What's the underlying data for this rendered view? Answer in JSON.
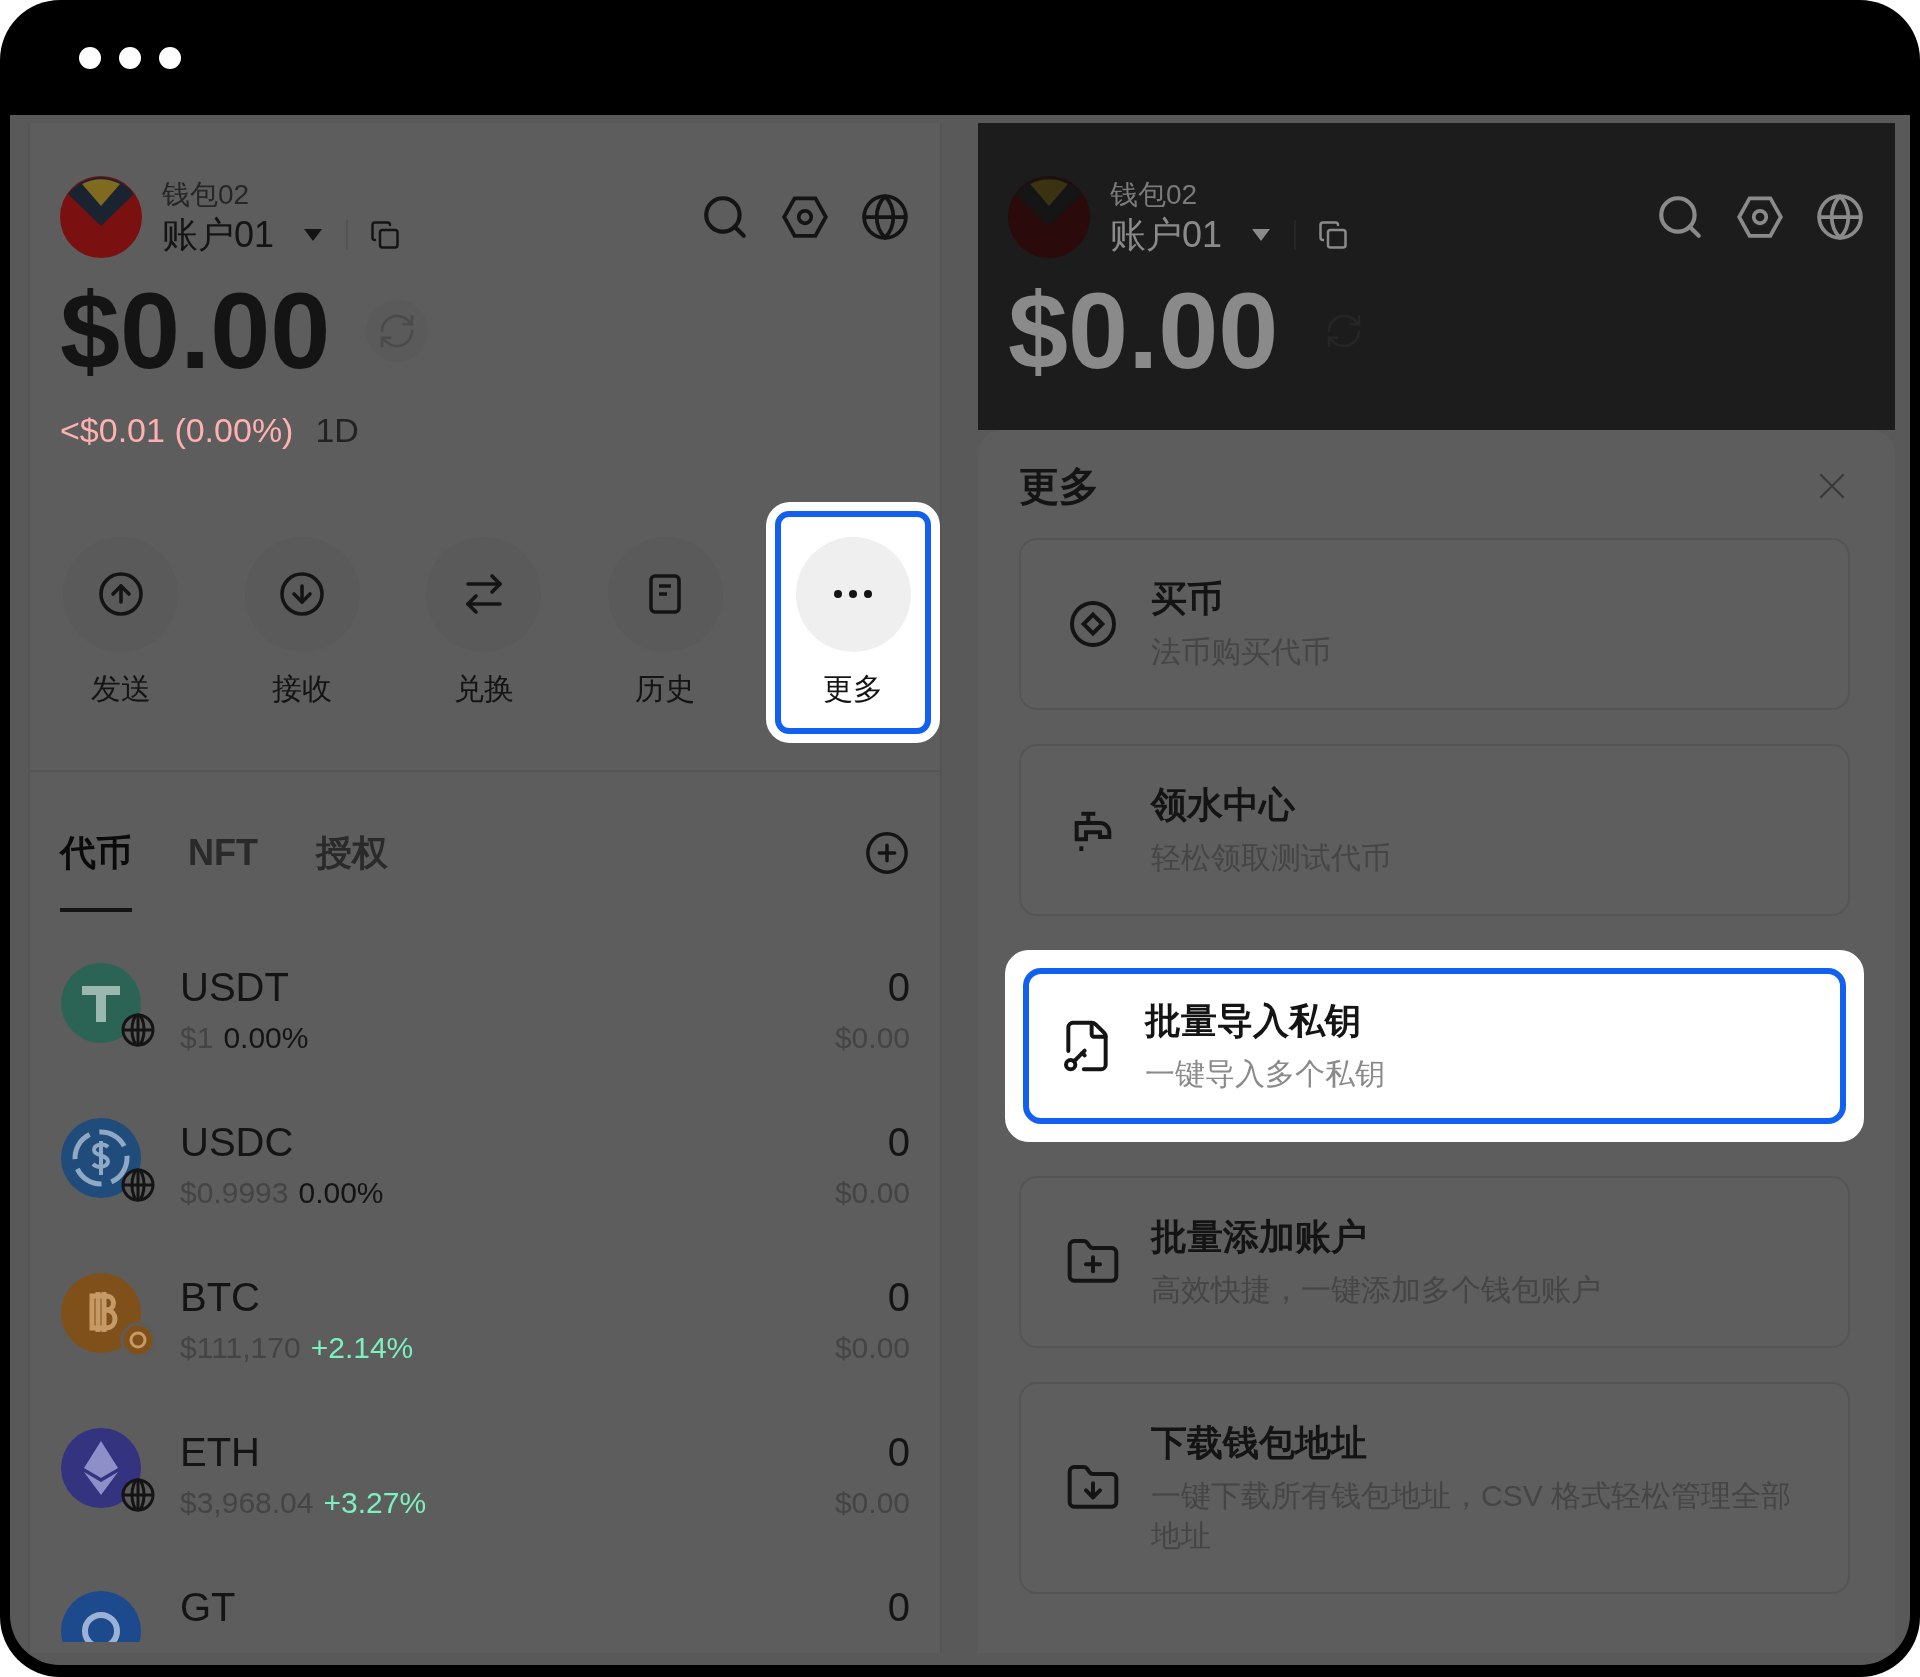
{
  "wallet": {
    "wallet_name": "钱包02",
    "account": "账户01",
    "balance": "$0.00",
    "change": "<$0.01 (0.00%)",
    "period": "1D",
    "actions": [
      {
        "label": "发送",
        "kind": "send",
        "highlighted": false
      },
      {
        "label": "接收",
        "kind": "receive",
        "highlighted": false
      },
      {
        "label": "兑换",
        "kind": "swap",
        "highlighted": false
      },
      {
        "label": "历史",
        "kind": "history",
        "highlighted": false
      },
      {
        "label": "更多",
        "kind": "more",
        "highlighted": true
      }
    ],
    "tabs": [
      {
        "label": "代币",
        "selected": true
      },
      {
        "label": "NFT",
        "selected": false
      },
      {
        "label": "授权",
        "selected": false
      }
    ],
    "tokens": [
      {
        "symbol": "USDT",
        "price": "$1",
        "change": {
          "text": "0.00%",
          "color": "#141414"
        },
        "amount": "0",
        "value": "$0.00",
        "kind": "usdt",
        "color": "#2b6455"
      },
      {
        "symbol": "USDC",
        "price": "$0.9993",
        "change": {
          "text": "0.00%",
          "color": "#141414"
        },
        "amount": "0",
        "value": "$0.00",
        "kind": "usdc",
        "color": "#1f4c7a"
      },
      {
        "symbol": "BTC",
        "price": "$111,170",
        "change": {
          "text": "+2.14%",
          "color": "#7cf0c0"
        },
        "amount": "0",
        "value": "$0.00",
        "kind": "btc",
        "color": "#80501a"
      },
      {
        "symbol": "ETH",
        "price": "$3,968.04",
        "change": {
          "text": "+3.27%",
          "color": "#7cf0c0"
        },
        "amount": "0",
        "value": "$0.00",
        "kind": "eth",
        "color": "#33337f"
      },
      {
        "symbol": "GT",
        "amount": "0",
        "kind": "gt",
        "color": "#1d4a8c"
      }
    ]
  },
  "background_wallet": {
    "wallet_name": "钱包02",
    "account": "账户01",
    "balance": "$0.00"
  },
  "more_sheet": {
    "title": "更多",
    "items": [
      {
        "title": "买币",
        "subtitle": "法币购买代币",
        "kind": "buy",
        "highlighted": false
      },
      {
        "title": "领水中心",
        "subtitle": "轻松领取测试代币",
        "kind": "faucet",
        "highlighted": false
      },
      {
        "title": "批量导入私钥",
        "subtitle": "一键导入多个私钥",
        "kind": "import",
        "highlighted": true
      },
      {
        "title": "批量添加账户",
        "subtitle": "高效快捷，一键添加多个钱包账户",
        "kind": "add",
        "highlighted": false
      },
      {
        "title": "下载钱包地址",
        "subtitle": "一键下载所有钱包地址，CSV 格式轻松管理全部地址",
        "kind": "download",
        "highlighted": false
      }
    ]
  }
}
